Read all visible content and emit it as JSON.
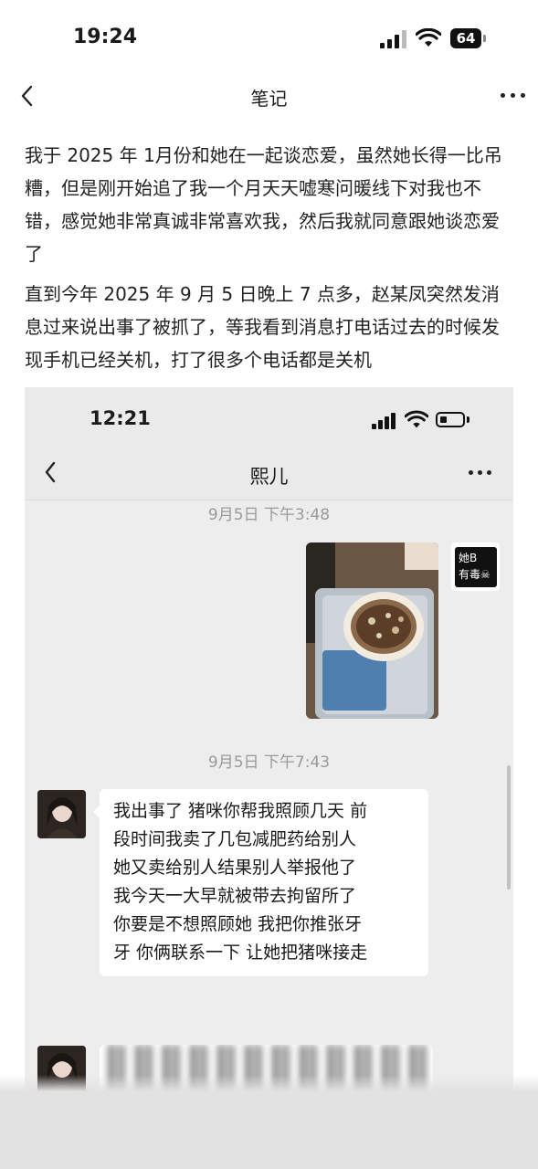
{
  "status_bar": {
    "time": "19:24",
    "battery": "64",
    "icons": [
      "cellular-signal-icon",
      "wifi-icon",
      "battery-icon"
    ]
  },
  "nav": {
    "title": "笔记",
    "back_icon": "chevron-left-icon",
    "more_icon": "ellipsis-icon"
  },
  "note": {
    "paragraphs": [
      "我于 2025 年 1月份和她在一起谈恋爱，虽然她长得一比吊糟，但是刚开始追了我一个月天天嘘寒问暖线下对我也不错，感觉她非常真诚非常喜欢我，然后我就同意跟她谈恋爱了",
      "直到今年 2025 年 9 月 5 日晚上 7 点多，赵某凤突然发消息过来说出事了被抓了，等我看到消息打电话过去的时候发现手机已经关机，打了很多个电话都是关机"
    ]
  },
  "chat_screenshot": {
    "status_time": "12:21",
    "contact_name": "熙儿",
    "timestamps": [
      "9月5日 下午3:48",
      "9月5日 下午7:43"
    ],
    "self_avatar_text": [
      "她B",
      "有毒☠"
    ],
    "messages": [
      {
        "lines": [
          "我出事了 猪咪你帮我照顾几天 前",
          "段时间我卖了几包减肥药给别人",
          "她又卖给别人结果别人举报他了",
          "我今天一大早就被带去拘留所了",
          "你要是不想照顾她 我把你推张牙",
          "牙 你俩联系一下 让她把猪咪接走"
        ]
      }
    ]
  },
  "colors": {
    "page_bg": "#ffffff",
    "chat_bg": "#ededed",
    "bubble_bg": "#ffffff",
    "timestamp": "#9a9a9a"
  }
}
